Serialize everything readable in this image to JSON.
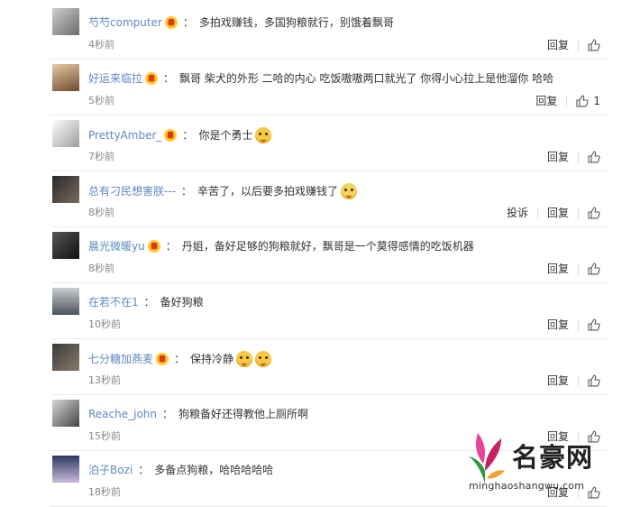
{
  "comments": [
    {
      "user": "芍芍computer",
      "vip": true,
      "text": "多拍戏赚钱，多国狗粮就行，别饿着飘哥",
      "emojis": [],
      "time": "4秒前",
      "actions": [
        "回复"
      ],
      "likes": ""
    },
    {
      "user": "好运来临拉",
      "vip": true,
      "text": "飘哥 柴犬的外形 二哈的内心 吃饭嗷嗷两口就光了 你得小心拉上是他溜你 哈哈",
      "emojis": [],
      "time": "5秒前",
      "actions": [
        "回复"
      ],
      "likes": "1"
    },
    {
      "user": "PrettyAmber_",
      "vip": true,
      "text": "你是个勇士",
      "emojis": [
        "doge"
      ],
      "time": "7秒前",
      "actions": [
        "回复"
      ],
      "likes": ""
    },
    {
      "user": "总有刁民想害朕---",
      "vip": false,
      "text": "辛苦了，以后要多拍戏赚钱了",
      "emojis": [
        "sweat"
      ],
      "time": "8秒前",
      "actions": [
        "投诉",
        "回复"
      ],
      "likes": ""
    },
    {
      "user": "晨光微暖yu",
      "vip": true,
      "text": "丹姐，备好足够的狗粮就好，飘哥是一个莫得感情的吃饭机器",
      "emojis": [],
      "time": "8秒前",
      "actions": [
        "回复"
      ],
      "likes": ""
    },
    {
      "user": "在若不在1",
      "vip": false,
      "text": "备好狗粮",
      "emojis": [],
      "time": "10秒前",
      "actions": [
        "回复"
      ],
      "likes": ""
    },
    {
      "user": "七分糖加燕麦",
      "vip": true,
      "text": "保持冷静",
      "emojis": [
        "doge",
        "doge"
      ],
      "time": "13秒前",
      "actions": [
        "回复"
      ],
      "likes": ""
    },
    {
      "user": "Reache_john",
      "vip": false,
      "text": "狗粮备好还得教他上厕所啊",
      "emojis": [],
      "time": "15秒前",
      "actions": [
        "回复"
      ],
      "likes": ""
    },
    {
      "user": "泊子Bozi",
      "vip": false,
      "text": "多备点狗粮，哈哈哈哈哈",
      "emojis": [],
      "time": "18秒前",
      "actions": [
        "回复"
      ],
      "likes": ""
    }
  ],
  "watermark": {
    "name": "名豪网",
    "url": "minghaoshangwu.com"
  },
  "colors": {
    "username": "#5d89c1",
    "text": "#333333",
    "time": "#888888",
    "divider": "#ececec"
  },
  "icons": {
    "like": "thumbs-up-icon",
    "vip": "vip-badge-icon",
    "emoji": "doge-emoji-icon"
  }
}
